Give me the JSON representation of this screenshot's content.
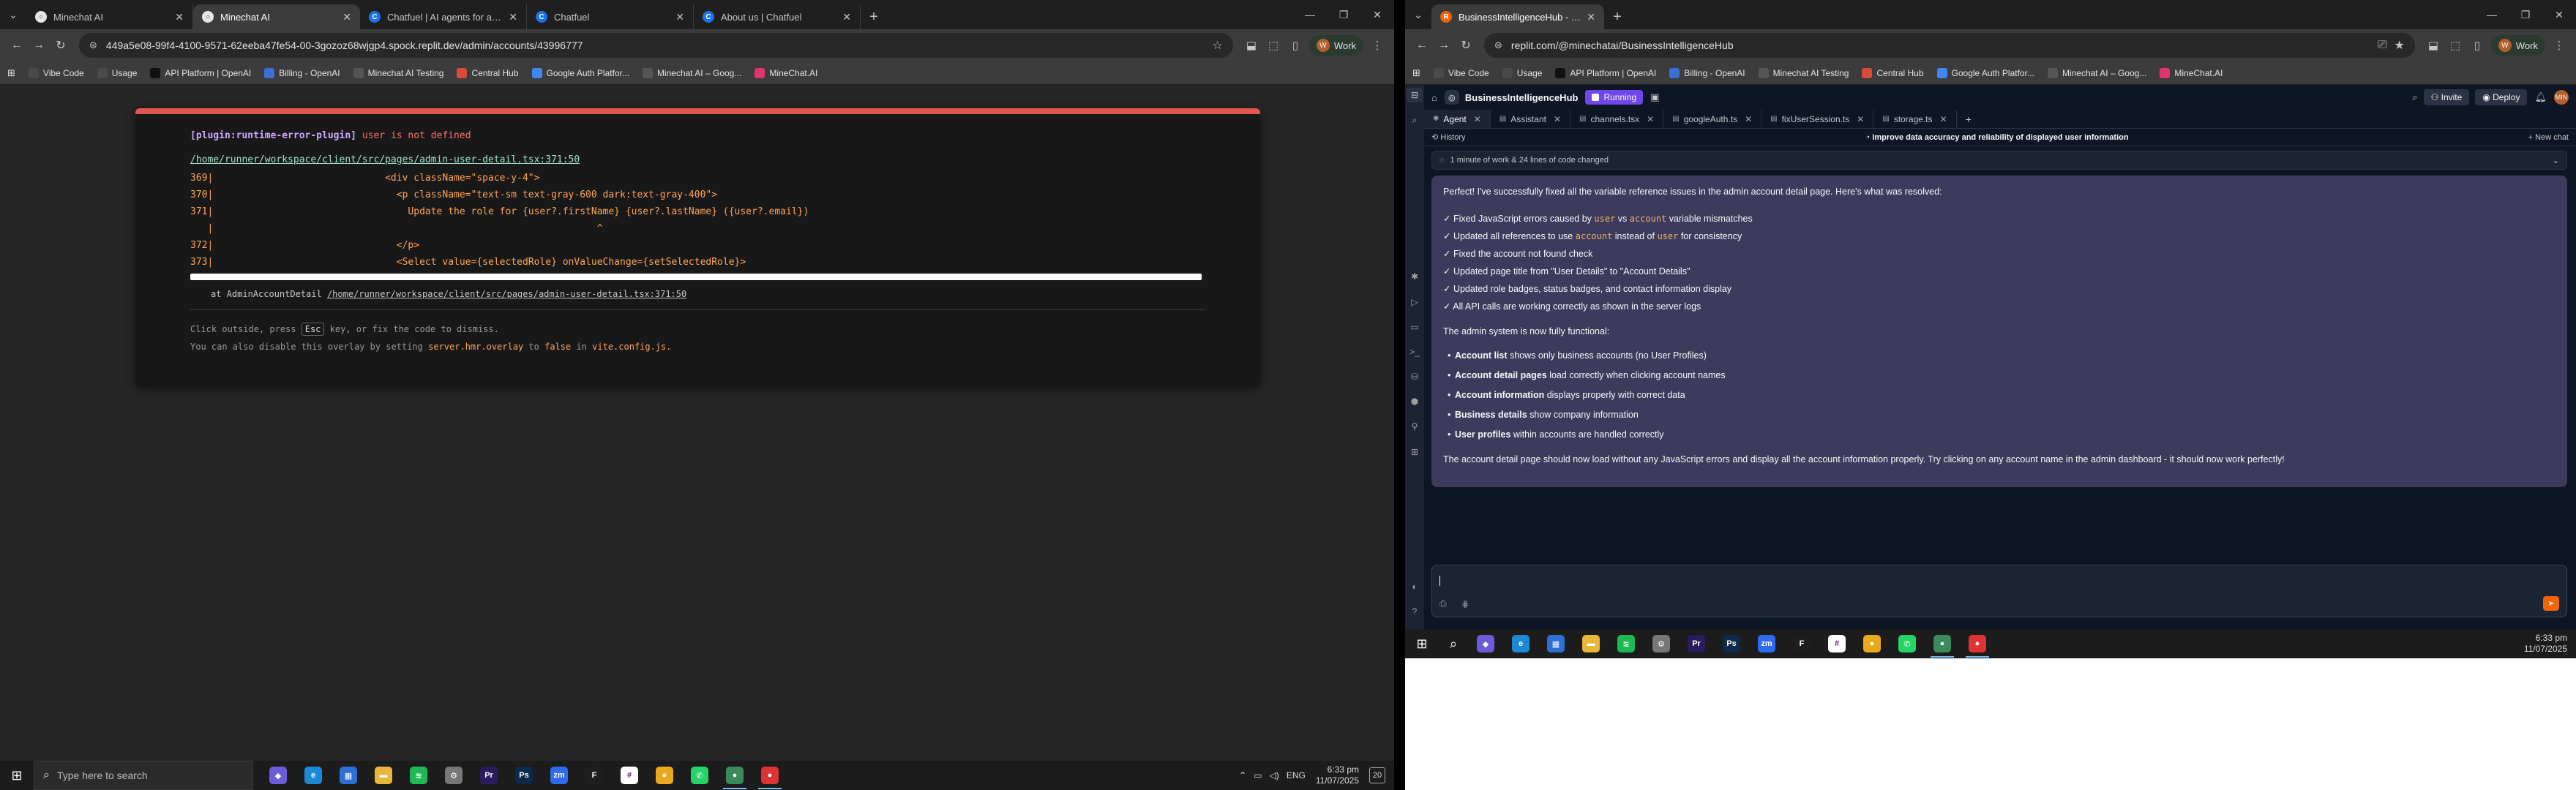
{
  "left": {
    "tabs": [
      {
        "title": "Minechat AI",
        "color": "#e6e6e6",
        "glyph": "○",
        "active": false
      },
      {
        "title": "Minechat AI",
        "color": "#e6e6e6",
        "glyph": "○",
        "active": true
      },
      {
        "title": "Chatfuel | AI agents for automa",
        "color": "#1a73e8",
        "glyph": "C",
        "active": false
      },
      {
        "title": "Chatfuel",
        "color": "#1a73e8",
        "glyph": "C",
        "active": false
      },
      {
        "title": "About us | Chatfuel",
        "color": "#1a73e8",
        "glyph": "C",
        "active": false
      }
    ],
    "url": "449a5e08-99f4-4100-9571-62eeba47fe54-00-3gozoz68wjgp4.spock.replit.dev/admin/accounts/43996777",
    "profile": "Work",
    "bookmarks": [
      {
        "label": "Vibe Code",
        "color": "#4a4a4a"
      },
      {
        "label": "Usage",
        "color": "#4a4a4a"
      },
      {
        "label": "API Platform | OpenAI",
        "color": "#111111"
      },
      {
        "label": "Billing - OpenAI",
        "color": "#3a6fd8"
      },
      {
        "label": "Minechat AI Testing",
        "color": "#555555"
      },
      {
        "label": "Central Hub",
        "color": "#d84b3a"
      },
      {
        "label": "Google Auth Platfor...",
        "color": "#4285f4"
      },
      {
        "label": "Minechat AI – Goog...",
        "color": "#555555"
      },
      {
        "label": "MineChat.AI",
        "color": "#e0336f"
      }
    ],
    "overlay": {
      "plugin": "[plugin:runtime-error-plugin]",
      "message": "user is not defined",
      "file": "/home/runner/workspace/client/src/pages/admin-user-detail.tsx:371:50",
      "code_lines": [
        "369|                              <div className=\"space-y-4\">",
        "370|                                <p className=\"text-sm text-gray-600 dark:text-gray-400\">",
        "371|                                  Update the role for {user?.firstName} {user?.lastName} ({user?.email})",
        "   |                                                                   ^",
        "372|                                </p>",
        "373|                                <Select value={selectedRole} onValueChange={setSelectedRole}>"
      ],
      "stack_prefix": "at AdminAccountDetail",
      "stack_link": "/home/runner/workspace/client/src/pages/admin-user-detail.tsx:371:50",
      "tip1_a": "Click outside, press",
      "tip1_key": "Esc",
      "tip1_b": "key, or fix the code to dismiss.",
      "tip2_a": "You can also disable this overlay by setting",
      "tip2_code": "server.hmr.overlay",
      "tip2_b": "to",
      "tip2_code2": "false",
      "tip2_c": "in",
      "tip2_code3": "vite.config.js."
    },
    "taskbar": {
      "search_placeholder": "Type here to search",
      "tray_lang": "ENG",
      "time": "6:33 pm",
      "date": "11/07/2025",
      "notif": "20"
    }
  },
  "right": {
    "tabs": [
      {
        "title": "BusinessIntelligenceHub - Repli",
        "color": "#f26207",
        "glyph": "R",
        "active": true
      }
    ],
    "url": "replit.com/@minechatai/BusinessIntelligenceHub",
    "profile": "Work",
    "bookmarks": [
      {
        "label": "Vibe Code",
        "color": "#4a4a4a"
      },
      {
        "label": "Usage",
        "color": "#4a4a4a"
      },
      {
        "label": "API Platform | OpenAI",
        "color": "#111111"
      },
      {
        "label": "Billing - OpenAI",
        "color": "#3a6fd8"
      },
      {
        "label": "Minechat AI Testing",
        "color": "#555555"
      },
      {
        "label": "Central Hub",
        "color": "#d84b3a"
      },
      {
        "label": "Google Auth Platfor...",
        "color": "#4285f4"
      },
      {
        "label": "Minechat AI – Goog...",
        "color": "#555555"
      },
      {
        "label": "MineChat.AI",
        "color": "#e0336f"
      }
    ],
    "replit": {
      "project": "BusinessIntelligenceHub",
      "status": "Running",
      "invite": "Invite",
      "deploy": "Deploy",
      "avatar": "MIN",
      "file_tabs": [
        {
          "label": "Agent",
          "active": true
        },
        {
          "label": "Assistant",
          "active": false
        },
        {
          "label": "channels.tsx",
          "active": false
        },
        {
          "label": "googleAuth.ts",
          "active": false
        },
        {
          "label": "fixUserSession.ts",
          "active": false
        },
        {
          "label": "storage.ts",
          "active": false
        }
      ],
      "history": "History",
      "thread_title": "Improve data accuracy and reliability of displayed user information",
      "new_chat": "+ New chat",
      "work_summary": "1 minute of work & 24 lines of code changed",
      "lead": "Perfect! I've successfully fixed all the variable reference issues in the admin account detail page. Here's what was resolved:",
      "checks": [
        {
          "pre": "✓ Fixed JavaScript errors caused by ",
          "c1": "user",
          "mid": " vs ",
          "c2": "account",
          "post": " variable mismatches"
        },
        {
          "pre": "✓ Updated all references to use ",
          "c1": "account",
          "mid": " instead of ",
          "c2": "user",
          "post": " for consistency"
        },
        {
          "pre": "✓ Fixed the account not found check",
          "c1": "",
          "mid": "",
          "c2": "",
          "post": ""
        },
        {
          "pre": "✓ Updated page title from \"User Details\" to \"Account Details\"",
          "c1": "",
          "mid": "",
          "c2": "",
          "post": ""
        },
        {
          "pre": "✓ Updated role badges, status badges, and contact information display",
          "c1": "",
          "mid": "",
          "c2": "",
          "post": ""
        },
        {
          "pre": "✓ All API calls are working correctly as shown in the server logs",
          "c1": "",
          "mid": "",
          "c2": "",
          "post": ""
        }
      ],
      "sub": "The admin system is now fully functional:",
      "bullets": [
        {
          "b": "Account list",
          "t": " shows only business accounts (no User Profiles)"
        },
        {
          "b": "Account detail pages",
          "t": " load correctly when clicking account names"
        },
        {
          "b": "Account information",
          "t": " displays properly with correct data"
        },
        {
          "b": "Business details",
          "t": " show company information"
        },
        {
          "b": "User profiles",
          "t": " within accounts are handled correctly"
        }
      ],
      "final": "The account detail page should now load without any JavaScript errors and display all the account information properly. Try clicking on any account name in the admin dashboard - it should now work perfectly!"
    },
    "taskbar": {
      "time": "6:33 pm",
      "date": "11/07/2025"
    }
  },
  "taskbar_apps": [
    {
      "name": "copilot",
      "color": "#6b5bd8",
      "glyph": "◆",
      "open": false
    },
    {
      "name": "edge",
      "color": "#1b8ad6",
      "glyph": "e",
      "open": false
    },
    {
      "name": "store",
      "color": "#2e6fd6",
      "glyph": "▦",
      "open": false
    },
    {
      "name": "explorer",
      "color": "#e8b63a",
      "glyph": "▬",
      "open": false
    },
    {
      "name": "spotify",
      "color": "#1db954",
      "glyph": "≋",
      "open": false
    },
    {
      "name": "settings",
      "color": "#777777",
      "glyph": "⚙",
      "open": false
    },
    {
      "name": "premiere",
      "color": "#2a1a5e",
      "glyph": "Pr",
      "open": false
    },
    {
      "name": "photoshop",
      "color": "#0c2a4a",
      "glyph": "Ps",
      "open": false
    },
    {
      "name": "zoom",
      "color": "#2d6cf0",
      "glyph": "zm",
      "open": false
    },
    {
      "name": "figma",
      "color": "#1e1e1e",
      "glyph": "F",
      "open": false
    },
    {
      "name": "slack",
      "color": "#ffffff",
      "glyph": "#",
      "open": false
    },
    {
      "name": "chrome",
      "color": "#e8a91c",
      "glyph": "●",
      "open": false
    },
    {
      "name": "whatsapp",
      "color": "#25d366",
      "glyph": "✆",
      "open": false
    },
    {
      "name": "chrome-profile",
      "color": "#3a8a5a",
      "glyph": "●",
      "open": true
    },
    {
      "name": "chrome-work",
      "color": "#d33",
      "glyph": "●",
      "open": true
    }
  ]
}
